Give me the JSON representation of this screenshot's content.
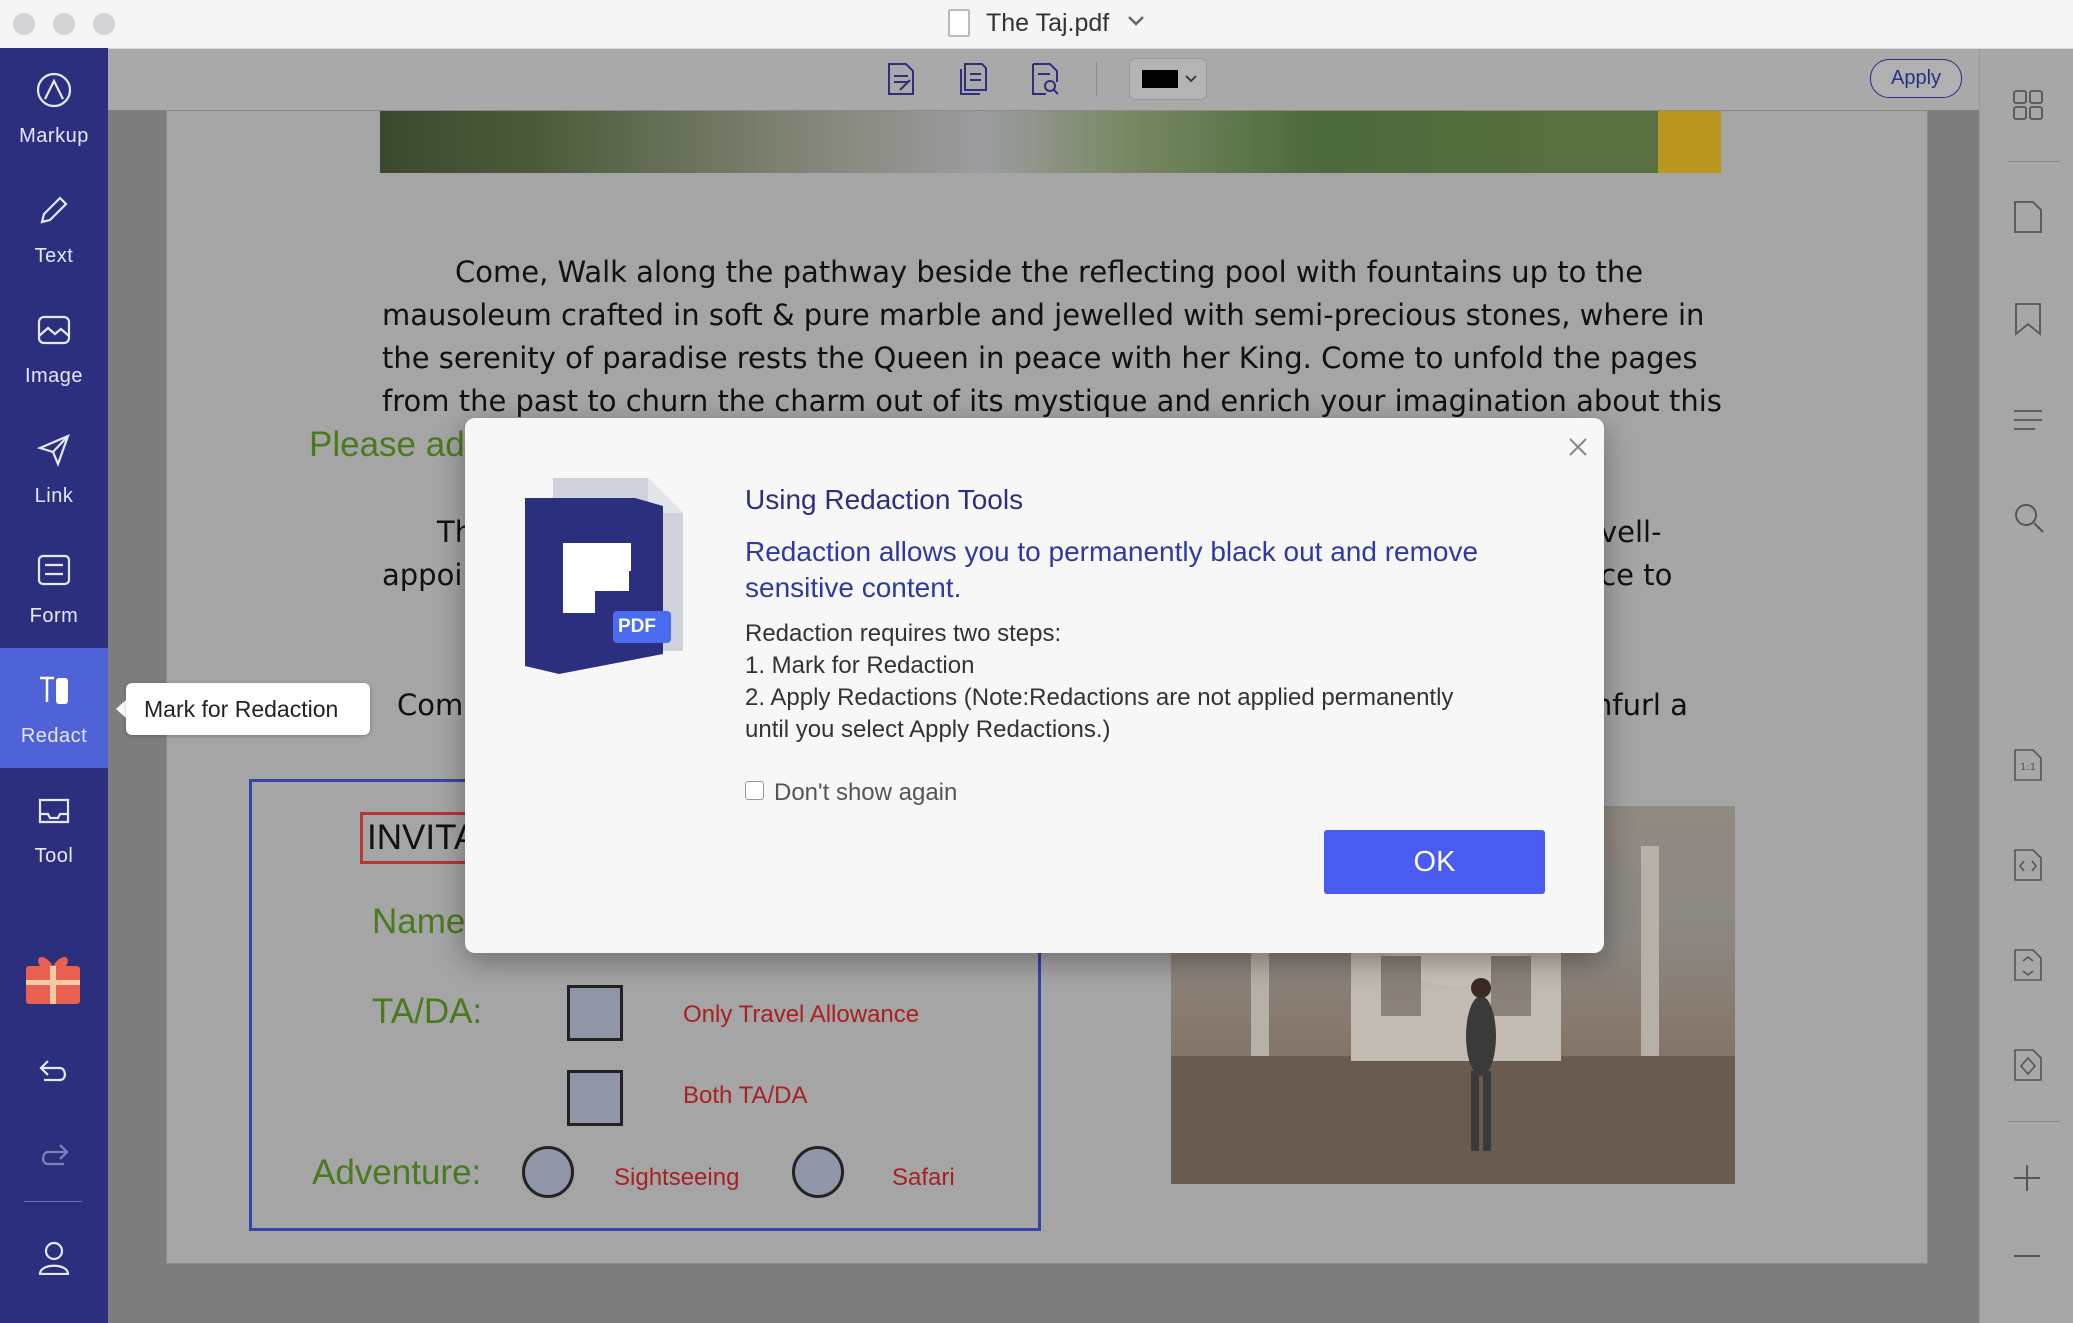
{
  "window": {
    "title": "The Taj.pdf"
  },
  "sidebar": {
    "items": [
      {
        "label": "Markup",
        "icon": "markup-icon"
      },
      {
        "label": "Text",
        "icon": "pencil-icon"
      },
      {
        "label": "Image",
        "icon": "image-icon"
      },
      {
        "label": "Link",
        "icon": "link-icon"
      },
      {
        "label": "Form",
        "icon": "form-icon"
      },
      {
        "label": "Redact",
        "icon": "redact-icon",
        "active": true
      },
      {
        "label": "Tool",
        "icon": "tool-icon"
      }
    ],
    "accent": "#4f62d8",
    "background": "#2b2f7e"
  },
  "tooltip": {
    "text": "Mark for Redaction"
  },
  "toolbar": {
    "apply_label": "Apply",
    "color_value": "#000000"
  },
  "document": {
    "paragraph1": [
      "Come, Walk along the pathway beside the reflecting pool with fountains up to the",
      "mausoleum crafted in soft & pure marble and jewelled with semi-precious stones, where in",
      "the serenity of paradise rests the Queen in peace with her King. Come to unfold the pages",
      "from the past to churn the charm out of its mystique and enrich your imagination about this"
    ],
    "green_hint": "Please add m",
    "para2_left_1": "Th",
    "para2_right_1": "vell-",
    "para2_left_2": "appoi",
    "para2_right_2": "ence to",
    "para3_left": "Com",
    "para3_right": "nfurl a",
    "form": {
      "invitation": "INVITA",
      "name_label": "Name",
      "tada_label": "TA/DA:",
      "option_travel": "Only Travel Allowance",
      "option_both": "Both TA/DA",
      "adventure_label": "Adventure:",
      "option_sightseeing": "Sightseeing",
      "option_safari": "Safari"
    }
  },
  "dialog": {
    "title": "Using Redaction Tools",
    "lead": "Redaction allows you to permanently black out and remove sensitive content.",
    "steps_intro": "Redaction requires two steps:",
    "step1": "1. Mark for Redaction",
    "step2a": "2. Apply Redactions (Note:Redactions are not applied permanently",
    "step2b": "until you select Apply Redactions.)",
    "dont_show": "Don't show again",
    "ok_label": "OK",
    "file_badge": "PDF"
  }
}
